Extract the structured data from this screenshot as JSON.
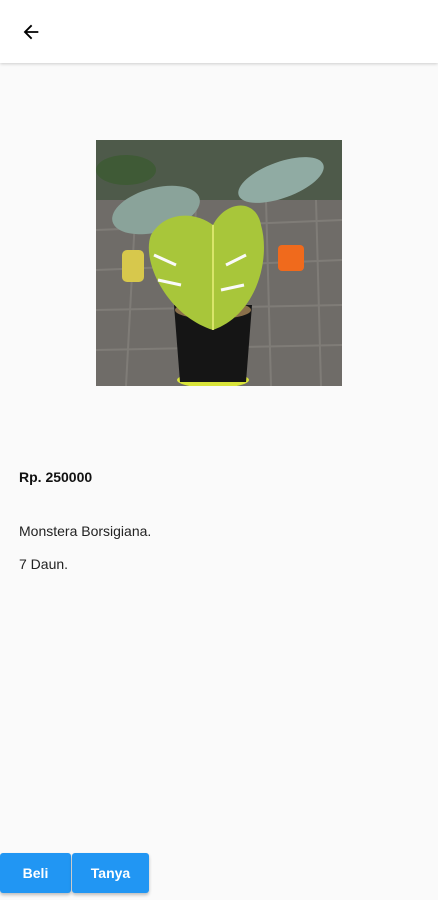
{
  "header": {
    "back_icon": "arrow-left-icon"
  },
  "product": {
    "image_alt": "monstera-plant-photo",
    "price": "Rp. 250000",
    "description_line1": "Monstera Borsigiana.",
    "description_line2": "7 Daun."
  },
  "actions": {
    "buy_label": "Beli",
    "ask_label": "Tanya"
  },
  "colors": {
    "accent": "#2196f3",
    "background": "#fafafa",
    "appbar": "#ffffff"
  }
}
